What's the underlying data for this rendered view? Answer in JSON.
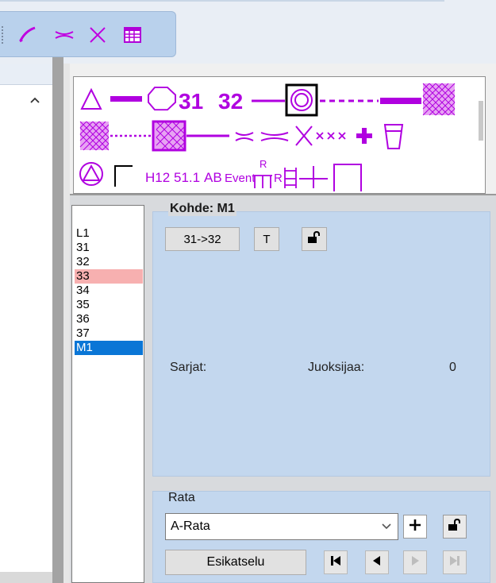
{
  "toolbar": {
    "icons": [
      "line-draw-icon",
      "crossing-icon",
      "cross-icon",
      "table-icon"
    ]
  },
  "palette": {
    "row1_labels": [
      "31",
      "32"
    ],
    "row3_labels": [
      "H12",
      "51.1",
      "AB",
      "Event",
      "R",
      "R"
    ],
    "symbol_names": [
      "triangle-icon",
      "bar-icon",
      "octagon-icon",
      "control-31-icon",
      "control-32-icon",
      "line-icon",
      "concentric-circles-icon",
      "dashed-line-icon",
      "thick-line-icon",
      "hatched-area-icon",
      "hatched-square-icon",
      "dotted-line-icon",
      "framed-hatched-icon",
      "line-icon-2",
      "crossing-point-icon",
      "wide-crossing-icon",
      "cross-icon",
      "triple-cross-icon",
      "first-aid-icon",
      "cup-icon",
      "circle-triangle-icon",
      "corner-icon",
      "h12-icon",
      "code-51-1-icon",
      "ab-icon",
      "event-icon",
      "r-table-icon",
      "r-ladder-icon",
      "plus-line-icon",
      "rectangle-icon"
    ]
  },
  "control_list": {
    "items": [
      "L1",
      "31",
      "32",
      "33",
      "34",
      "35",
      "36",
      "37",
      "M1"
    ],
    "warning_item": "33",
    "selected_item": "M1"
  },
  "kohde": {
    "title": "Kohde: M1",
    "swap_label": "31->32",
    "t_label": "T",
    "sarjat_label": "Sarjat:",
    "juoksijaa_label": "Juoksijaa:",
    "juoksijaa_count": "0"
  },
  "rata": {
    "title": "Rata",
    "selected_course": "A-Rata",
    "preview_label": "Esikatselu"
  },
  "colors": {
    "accent_purple": "#b000e0",
    "selection_blue": "#0a76d6",
    "warning_pink": "#f7b0b0",
    "panel_blue": "#c3d7ee"
  }
}
